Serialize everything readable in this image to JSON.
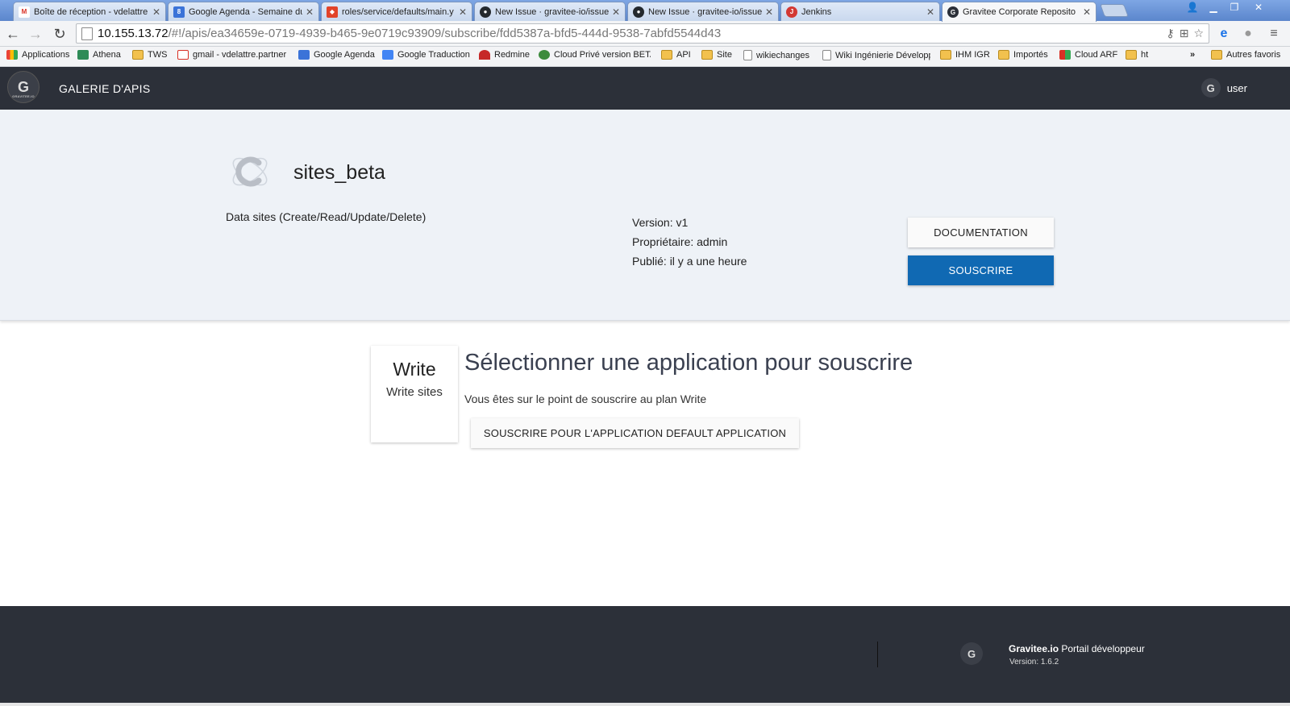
{
  "browser": {
    "tabs": [
      {
        "title": "Boîte de réception - vdelattre",
        "icon": "gmail-icon",
        "color": "#d93025"
      },
      {
        "title": "Google Agenda - Semaine du",
        "icon": "calendar-icon",
        "color": "#3b73d8"
      },
      {
        "title": "roles/service/defaults/main.y",
        "icon": "gitlab-icon",
        "color": "#e24329"
      },
      {
        "title": "New Issue · gravitee-io/issue",
        "icon": "github-icon",
        "color": "#24292e"
      },
      {
        "title": "New Issue · gravitee-io/issue",
        "icon": "github-icon",
        "color": "#24292e"
      },
      {
        "title": "Jenkins",
        "icon": "jenkins-icon",
        "color": "#d33833"
      },
      {
        "title": "Gravitee Corporate Reposito",
        "icon": "gravitee-icon",
        "color": "#2c3039"
      }
    ],
    "url_host": "10.155.13.72",
    "url_path": "/#!/apis/ea34659e-0719-4939-b465-9e0719c93909/subscribe/fdd5387a-bfd5-444d-9538-7abfd5544d43",
    "bookmarks": [
      {
        "label": "Applications",
        "type": "apps"
      },
      {
        "label": "Athena",
        "type": "site"
      },
      {
        "label": "TWS",
        "type": "folder"
      },
      {
        "label": "gmail - vdelattre.partner",
        "type": "site"
      },
      {
        "label": "Google Agenda",
        "type": "site"
      },
      {
        "label": "Google Traduction",
        "type": "site"
      },
      {
        "label": "Redmine",
        "type": "site"
      },
      {
        "label": "Cloud Privé version BETA",
        "type": "site"
      },
      {
        "label": "API",
        "type": "folder"
      },
      {
        "label": "Site",
        "type": "folder"
      },
      {
        "label": "wikiechanges",
        "type": "doc"
      },
      {
        "label": "Wiki Ingénierie Développ",
        "type": "doc"
      },
      {
        "label": "IHM IGR",
        "type": "folder"
      },
      {
        "label": "Importés",
        "type": "folder"
      },
      {
        "label": "Cloud ARF",
        "type": "site"
      },
      {
        "label": "ht",
        "type": "folder"
      }
    ],
    "more_bookmarks": "»",
    "other_bookmarks": "Autres favoris"
  },
  "header": {
    "logo_text": "GRAVITEE.IO",
    "title": "GALERIE D'APIS",
    "user": "user"
  },
  "api": {
    "name": "sites_beta",
    "description": "Data sites (Create/Read/Update/Delete)",
    "version": "Version: v1",
    "owner": "Propriétaire: admin",
    "published": "Publié: il y a une heure",
    "doc_button": "DOCUMENTATION",
    "subscribe_button": "SOUSCRIRE"
  },
  "plan": {
    "name": "Write",
    "description": "Write sites"
  },
  "main": {
    "title": "Sélectionner une application pour souscrire",
    "subtitle": "Vous êtes sur le point de souscrire au plan Write",
    "app_button": "SOUSCRIRE POUR L'APPLICATION DEFAULT APPLICATION"
  },
  "footer": {
    "brand_bold": "Gravitee.io",
    "brand_rest": " Portail développeur",
    "version": "Version: 1.6.2"
  },
  "colors": {
    "header_bg": "#2c3039",
    "banner_bg": "#eef2f7",
    "primary": "#1069b3"
  }
}
